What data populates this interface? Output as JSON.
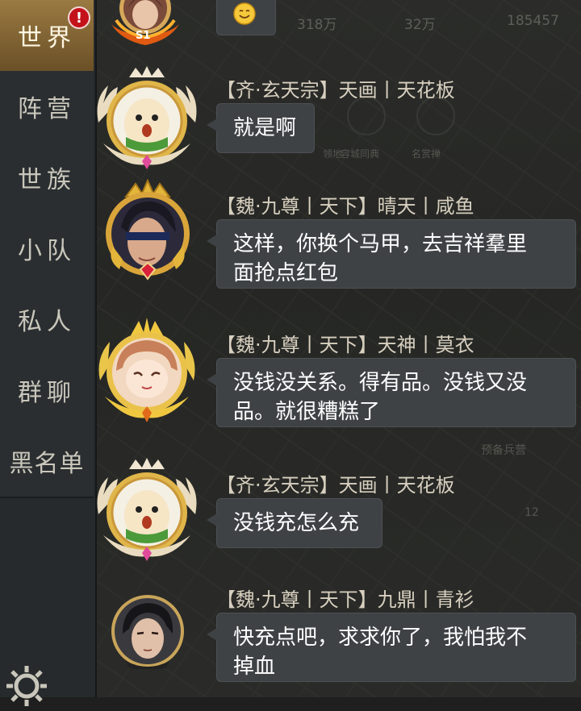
{
  "sidebar": {
    "tabs": [
      {
        "label": "世界",
        "active": true,
        "badge": "!"
      },
      {
        "label": "阵营"
      },
      {
        "label": "世族"
      },
      {
        "label": "小队"
      },
      {
        "label": "私人"
      },
      {
        "label": "群聊"
      },
      {
        "label": "黑名单"
      }
    ],
    "settings_icon": "gear-icon"
  },
  "background": {
    "resources": [
      "318万",
      "32万",
      "185457"
    ],
    "faded_labels": [
      "领地",
      "容城同典",
      "名赏禅"
    ],
    "map_labels": [
      "预备兵营",
      "12"
    ]
  },
  "top_message": {
    "avatar_level": "S1",
    "emoji": "smile-emoji"
  },
  "messages": [
    {
      "name": "【齐·玄天宗】天画丨天花板",
      "text": "就是啊",
      "avatar": "egg-character-avatar"
    },
    {
      "name": "【魏·九尊丨天下】晴天丨咸鱼",
      "text": "这样，你换个马甲，去吉祥羣里面抢点红包",
      "text_lines": [
        "这样，你换个马甲，去吉祥羣里",
        "面抢点红包"
      ],
      "avatar": "blindfold-warrior-avatar"
    },
    {
      "name": "【魏·九尊丨天下】天神丨莫衣",
      "text": "没钱没关系。得有品。没钱又没品。就很糟糕了",
      "text_lines": [
        "没钱没关系。得有品。没钱又没",
        "品。就很糟糕了"
      ],
      "avatar": "girl-character-avatar"
    },
    {
      "name": "【齐·玄天宗】天画丨天花板",
      "text": "没钱充怎么充",
      "avatar": "egg-character-avatar"
    },
    {
      "name": "【魏·九尊丨天下】九鼎丨青衫",
      "text": "快充点吧，求求你了，我怕我不掉血",
      "text_lines": [
        "快充点吧，求求你了，我怕我不",
        "掉血"
      ],
      "avatar": "swordsman-avatar"
    }
  ],
  "colors": {
    "active_tab": "#8a6a35",
    "bubble": "#3f4245",
    "name_text": "#d7cfbf"
  }
}
